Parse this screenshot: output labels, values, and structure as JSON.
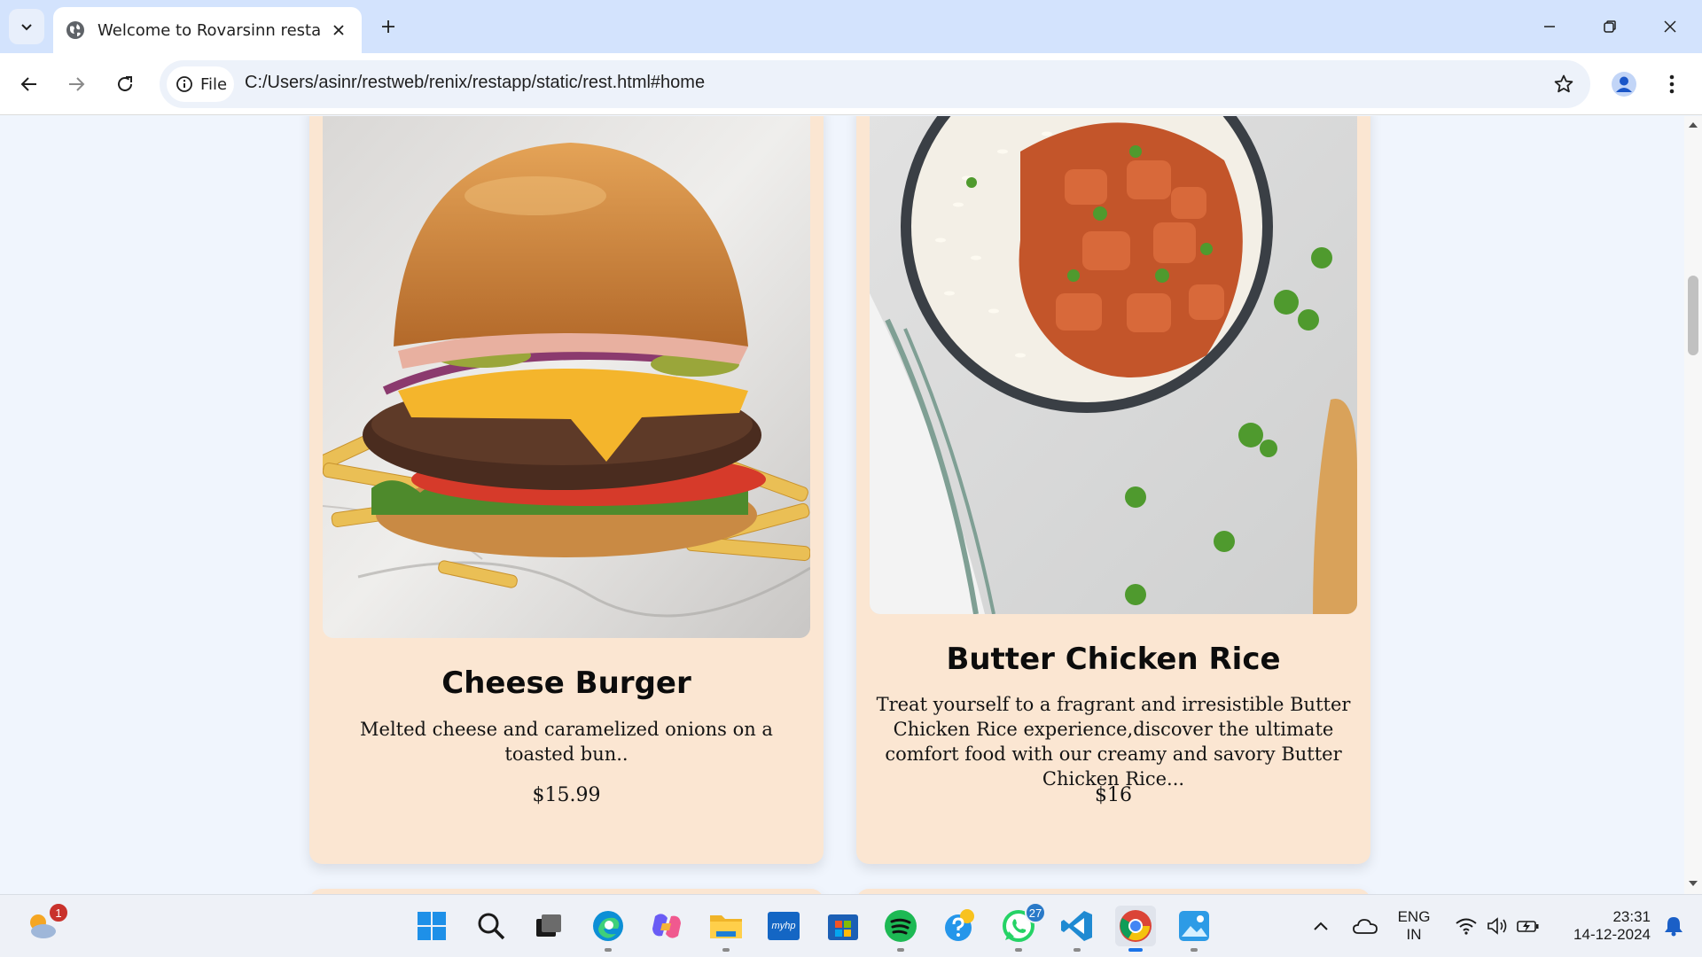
{
  "browser": {
    "tab_title": "Welcome to Rovarsinn restaura",
    "omnibox_chip": "File",
    "url": "C:/Users/asinr/restweb/renix/restapp/static/rest.html#home",
    "accent": "#d3e3fd"
  },
  "cards": [
    {
      "title": "Cheese Burger",
      "description": "Melted cheese and caramelized onions on a toasted bun..",
      "price": "$15.99",
      "image": "cheese-burger-photo"
    },
    {
      "title": "Butter Chicken Rice",
      "description": "Treat yourself to a fragrant and irresistible Butter Chicken Rice experience,discover the ultimate comfort food with our creamy and savory Butter Chicken Rice...",
      "price": "$16",
      "image": "butter-chicken-rice-photo"
    }
  ],
  "colors": {
    "card_bg": "#fbe6d2",
    "page_bg": "#f0f5fd"
  },
  "taskbar": {
    "weather_badge": "1",
    "whatsapp_badge": "27",
    "hp_label": "myhp",
    "lang": "ENG",
    "region": "IN",
    "time": "23:31",
    "date": "14-12-2024"
  }
}
